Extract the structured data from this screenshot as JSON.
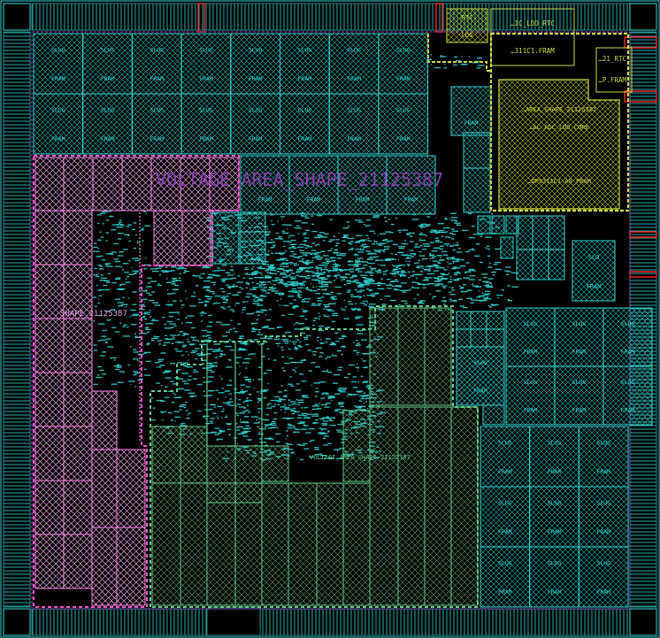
{
  "colors": {
    "background": "#000000",
    "fram": "#33d6d6",
    "magenta": "#ff88ee",
    "green": "#66cc88",
    "yellow": "#ccdd44",
    "red": "#ff2222",
    "purple": "#aa44dd",
    "pink_dash": "#ff55cc"
  },
  "labels": {
    "fram_top": "FRAM",
    "fram_small": "SLUG",
    "top_ldo": "…IC_LDO_RTC",
    "top_fram": "…311C1.FRAM",
    "top_rtc": "…21_RTC",
    "top_pfram": "…P.FRAM",
    "top_tiny": "RTC",
    "top_tiny2": "LDO",
    "core_shape": "…AREA_SHAPE_21125387",
    "core_ldo": "…AC_ADC_LDO_CORE",
    "core_fram": "…DPS311C1.A0_FRAM",
    "voltage_area": "VOLTAGE_AREA_SHAPE_21125387",
    "shape_left": "SHAPE_21125387",
    "green_shape": "VOLTAGE_AREA_SHAPE_21125387",
    "slo": "SLO",
    "fram_right": "FRAM"
  }
}
